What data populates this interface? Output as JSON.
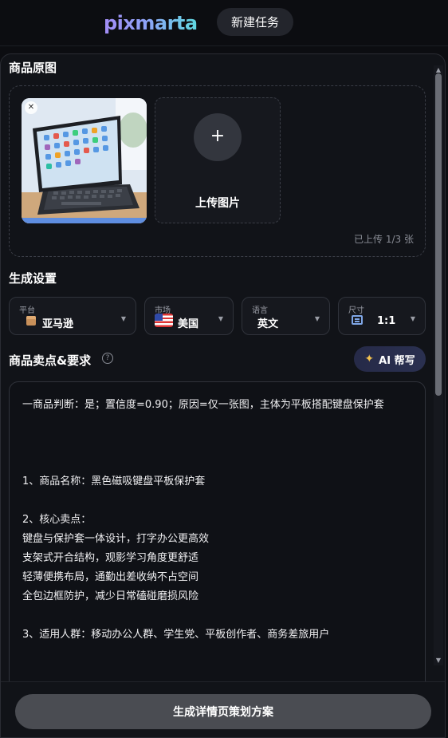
{
  "header": {
    "logo_text": "pixmarta",
    "new_task_label": "新建任务"
  },
  "product_images": {
    "title": "商品原图",
    "upload_label": "上传图片",
    "plus_symbol": "+",
    "upload_count": "已上传 1/3 张"
  },
  "settings": {
    "title": "生成设置",
    "platform": {
      "label": "平台",
      "value": "亚马逊",
      "icon": "box-icon"
    },
    "market": {
      "label": "市场",
      "value": "美国",
      "icon": "us-flag-icon"
    },
    "language": {
      "label": "语言",
      "value": "英文"
    },
    "size": {
      "label": "尺寸",
      "value": "1:1",
      "icon": "aspect-ratio-icon"
    }
  },
  "selling_points": {
    "title": "商品卖点&要求",
    "help_symbol": "?",
    "ai_button_label": "AI 帮写",
    "text": "一商品判断：是；置信度=0.90；原因=仅一张图，主体为平板搭配键盘保护套\n\n\n\n1、商品名称：黑色磁吸键盘平板保护套\n\n2、核心卖点：\n键盘与保护套一体设计，打字办公更高效\n支架式开合结构，观影学习角度更舒适\n轻薄便携布局，通勤出差收纳不占空间\n全包边框防护，减少日常磕碰磨损风险\n\n3、适用人群：移动办公人群、学生党、平板创作者、商务差旅用户"
  },
  "footer": {
    "generate_label": "生成详情页策划方案"
  },
  "colors": {
    "background": "#0c0d11",
    "panel": "#111318",
    "accent_gradient_start": "#a28cf5",
    "accent_gradient_end": "#5fd8e0",
    "ai_spark": "#f2c14e"
  }
}
